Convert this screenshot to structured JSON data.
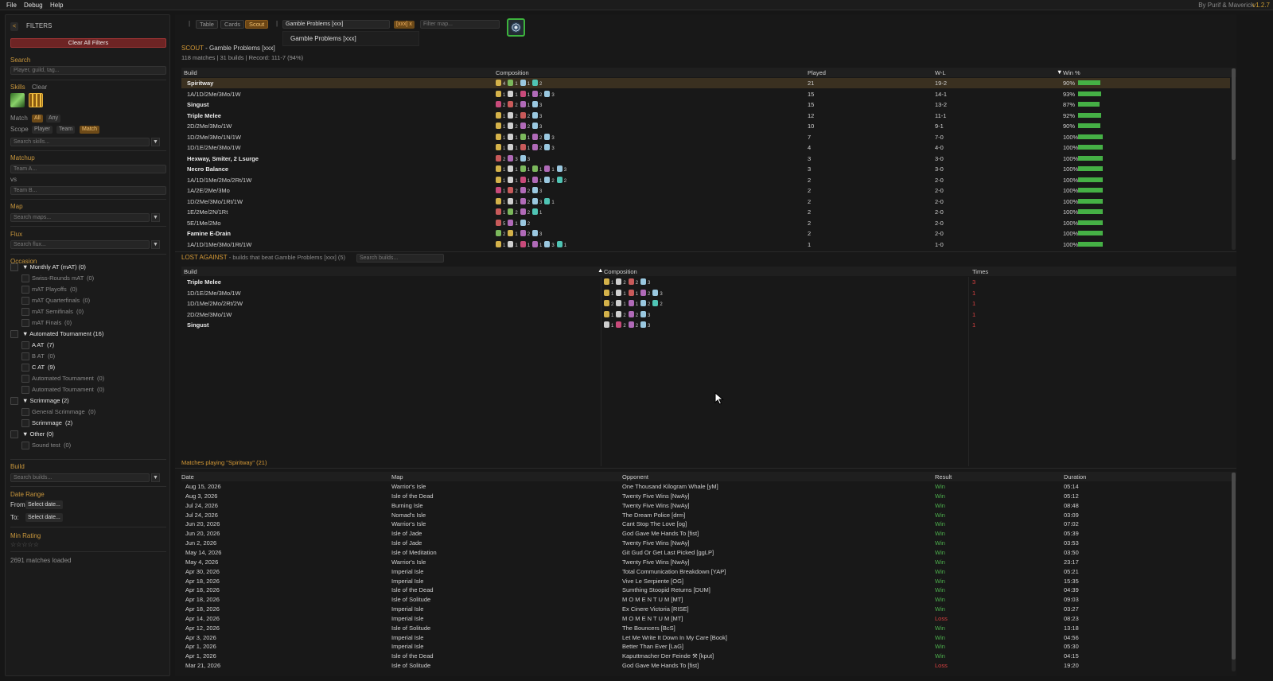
{
  "menu": {
    "file": "File",
    "debug": "Debug",
    "help": "Help",
    "credit": "By Purif & Maverick",
    "version": "v1.2.7"
  },
  "sidebar": {
    "back_label": "<",
    "title": "FILTERS",
    "clear_all": "Clear All Filters",
    "search": {
      "header": "Search",
      "placeholder": "Player, guild, tag..."
    },
    "skills": {
      "header": "Skills",
      "clear": "Clear",
      "search_placeholder": "Search skills..."
    },
    "match": {
      "label": "Match",
      "options": [
        "All",
        "Any"
      ],
      "selected": "All"
    },
    "scope": {
      "label": "Scope",
      "options": [
        "Player",
        "Team",
        "Match"
      ],
      "selected": "Match"
    },
    "matchup": {
      "header": "Matchup",
      "team_a": "Team A...",
      "vs": "vs",
      "team_b": "Team B..."
    },
    "map": {
      "header": "Map",
      "placeholder": "Search maps..."
    },
    "flux": {
      "header": "Flux",
      "placeholder": "Search flux..."
    },
    "occasion": {
      "header": "Occasion",
      "groups": [
        {
          "label": "▼ Monthly AT (mAT) (0)",
          "items": [
            {
              "label": "Swiss-Rounds mAT",
              "count": "(0)"
            },
            {
              "label": "mAT Playoffs",
              "count": "(0)"
            },
            {
              "label": "mAT Quarterfinals",
              "count": "(0)"
            },
            {
              "label": "mAT Semifinals",
              "count": "(0)"
            },
            {
              "label": "mAT Finals",
              "count": "(0)"
            }
          ]
        },
        {
          "label": "▼ Automated Tournament (16)",
          "items": [
            {
              "label": "A AT",
              "count": "(7)"
            },
            {
              "label": "B AT",
              "count": "(0)"
            },
            {
              "label": "C AT",
              "count": "(9)"
            },
            {
              "label": "Automated Tournament",
              "count": "(0)"
            },
            {
              "label": "Automated Tournament",
              "count": "(0)"
            }
          ]
        },
        {
          "label": "▼ Scrimmage (2)",
          "items": [
            {
              "label": "General Scrimmage",
              "count": "(0)"
            },
            {
              "label": "Scrimmage",
              "count": "(2)"
            }
          ]
        },
        {
          "label": "▼ Other (0)",
          "items": [
            {
              "label": "Sound test",
              "count": "(0)"
            }
          ]
        }
      ]
    },
    "build": {
      "header": "Build",
      "placeholder": "Search builds..."
    },
    "date_range": {
      "header": "Date Range",
      "from_label": "From",
      "from_value": "Select date...",
      "to_label": "To:",
      "to_value": "Select date..."
    },
    "min_rating": {
      "header": "Min Rating",
      "stars": "☆☆☆☆☆"
    },
    "status": "2691 matches loaded"
  },
  "toolbar": {
    "divider": "|",
    "tabs": [
      "Table",
      "Cards",
      "Scout"
    ],
    "active_tab": "Scout",
    "divider2": "|",
    "team_search_value": "Gamble Problems [xxx]",
    "team_tag": "[xxx] x",
    "filter_map_placeholder": "Filter map...",
    "dropdown_item": "Gamble Problems [xxx]"
  },
  "scout": {
    "label": "SCOUT",
    "team": "- Gamble Problems [xxx]",
    "summary": "118 matches | 31 builds | Record: 111-7 (94%)",
    "columns": [
      "Build",
      "Composition",
      "Played",
      "W-L",
      "Win %"
    ],
    "sort_indicator": "▼",
    "rows": [
      {
        "build": "Spiritway",
        "bold": true,
        "comp": [
          [
            "#d4b24a",
            "4"
          ],
          [
            "#7bb85c",
            "1"
          ],
          [
            "#9ac8e0",
            "1"
          ],
          [
            "#4fc4b4",
            "2"
          ]
        ],
        "played": "21",
        "wl": "19-2",
        "win": "90%",
        "winpct": 90
      },
      {
        "build": "1A/1D/2Me/3Mo/1W",
        "bold": false,
        "comp": [
          [
            "#d4b24a",
            "1"
          ],
          [
            "#cfcfcf",
            "1"
          ],
          [
            "#c84a7a",
            "1"
          ],
          [
            "#b06ab8",
            "2"
          ],
          [
            "#9ac8e0",
            "3"
          ]
        ],
        "played": "15",
        "wl": "14-1",
        "win": "93%",
        "winpct": 93
      },
      {
        "build": "Singust",
        "bold": true,
        "comp": [
          [
            "#c84a7a",
            "2"
          ],
          [
            "#c85a5a",
            "2"
          ],
          [
            "#b06ab8",
            "1"
          ],
          [
            "#9ac8e0",
            "3"
          ]
        ],
        "played": "15",
        "wl": "13-2",
        "win": "87%",
        "winpct": 87
      },
      {
        "build": "Triple Melee",
        "bold": true,
        "comp": [
          [
            "#d4b24a",
            "1"
          ],
          [
            "#cfcfcf",
            "2"
          ],
          [
            "#c85a5a",
            "2"
          ],
          [
            "#9ac8e0",
            "3"
          ]
        ],
        "played": "12",
        "wl": "11-1",
        "win": "92%",
        "winpct": 92
      },
      {
        "build": "2D/2Me/3Mo/1W",
        "bold": false,
        "comp": [
          [
            "#d4b24a",
            "1"
          ],
          [
            "#cfcfcf",
            "2"
          ],
          [
            "#b06ab8",
            "2"
          ],
          [
            "#9ac8e0",
            "3"
          ]
        ],
        "played": "10",
        "wl": "9-1",
        "win": "90%",
        "winpct": 90
      },
      {
        "build": "1D/2Me/3Mo/1N/1W",
        "bold": false,
        "comp": [
          [
            "#d4b24a",
            "1"
          ],
          [
            "#cfcfcf",
            "1"
          ],
          [
            "#7bb85c",
            "1"
          ],
          [
            "#b06ab8",
            "2"
          ],
          [
            "#9ac8e0",
            "3"
          ]
        ],
        "played": "7",
        "wl": "7-0",
        "win": "100%",
        "winpct": 100
      },
      {
        "build": "1D/1E/2Me/3Mo/1W",
        "bold": false,
        "comp": [
          [
            "#d4b24a",
            "1"
          ],
          [
            "#cfcfcf",
            "1"
          ],
          [
            "#c85a5a",
            "1"
          ],
          [
            "#b06ab8",
            "2"
          ],
          [
            "#9ac8e0",
            "3"
          ]
        ],
        "played": "4",
        "wl": "4-0",
        "win": "100%",
        "winpct": 100
      },
      {
        "build": "Hexway, Smiter, 2 Lsurge",
        "bold": true,
        "comp": [
          [
            "#c85a5a",
            "2"
          ],
          [
            "#b06ab8",
            "3"
          ],
          [
            "#9ac8e0",
            "3"
          ]
        ],
        "played": "3",
        "wl": "3-0",
        "win": "100%",
        "winpct": 100
      },
      {
        "build": "Necro Balance",
        "bold": true,
        "comp": [
          [
            "#d4b24a",
            "1"
          ],
          [
            "#cfcfcf",
            "1"
          ],
          [
            "#7bb85c",
            "1"
          ],
          [
            "#7bb85c",
            "1"
          ],
          [
            "#b06ab8",
            "1"
          ],
          [
            "#9ac8e0",
            "3"
          ]
        ],
        "played": "3",
        "wl": "3-0",
        "win": "100%",
        "winpct": 100
      },
      {
        "build": "1A/1D/1Me/2Mo/2Rt/1W",
        "bold": false,
        "comp": [
          [
            "#d4b24a",
            "1"
          ],
          [
            "#cfcfcf",
            "1"
          ],
          [
            "#c84a7a",
            "1"
          ],
          [
            "#b06ab8",
            "1"
          ],
          [
            "#9ac8e0",
            "2"
          ],
          [
            "#4fc4b4",
            "2"
          ]
        ],
        "played": "2",
        "wl": "2-0",
        "win": "100%",
        "winpct": 100
      },
      {
        "build": "1A/2E/2Me/3Mo",
        "bold": false,
        "comp": [
          [
            "#c84a7a",
            "1"
          ],
          [
            "#c85a5a",
            "2"
          ],
          [
            "#b06ab8",
            "2"
          ],
          [
            "#9ac8e0",
            "3"
          ]
        ],
        "played": "2",
        "wl": "2-0",
        "win": "100%",
        "winpct": 100
      },
      {
        "build": "1D/2Me/3Mo/1Rt/1W",
        "bold": false,
        "comp": [
          [
            "#d4b24a",
            "1"
          ],
          [
            "#cfcfcf",
            "1"
          ],
          [
            "#b06ab8",
            "2"
          ],
          [
            "#9ac8e0",
            "3"
          ],
          [
            "#4fc4b4",
            "1"
          ]
        ],
        "played": "2",
        "wl": "2-0",
        "win": "100%",
        "winpct": 100
      },
      {
        "build": "1E/2Me/2N/1Rt",
        "bold": false,
        "comp": [
          [
            "#c85a5a",
            "1"
          ],
          [
            "#7bb85c",
            "2"
          ],
          [
            "#b06ab8",
            "2"
          ],
          [
            "#4fc4b4",
            "1"
          ]
        ],
        "played": "2",
        "wl": "2-0",
        "win": "100%",
        "winpct": 100
      },
      {
        "build": "5E/1Me/2Mo",
        "bold": false,
        "comp": [
          [
            "#c85a5a",
            "5"
          ],
          [
            "#b06ab8",
            "1"
          ],
          [
            "#9ac8e0",
            "2"
          ]
        ],
        "played": "2",
        "wl": "2-0",
        "win": "100%",
        "winpct": 100
      },
      {
        "build": "Famine E-Drain",
        "bold": true,
        "comp": [
          [
            "#7bb85c",
            "2"
          ],
          [
            "#d4b24a",
            "1"
          ],
          [
            "#b06ab8",
            "2"
          ],
          [
            "#9ac8e0",
            "3"
          ]
        ],
        "played": "2",
        "wl": "2-0",
        "win": "100%",
        "winpct": 100
      },
      {
        "build": "1A/1D/1Me/3Mo/1Rt/1W",
        "bold": false,
        "comp": [
          [
            "#d4b24a",
            "1"
          ],
          [
            "#cfcfcf",
            "1"
          ],
          [
            "#c84a7a",
            "1"
          ],
          [
            "#b06ab8",
            "1"
          ],
          [
            "#9ac8e0",
            "3"
          ],
          [
            "#4fc4b4",
            "1"
          ]
        ],
        "played": "1",
        "wl": "1-0",
        "win": "100%",
        "winpct": 100
      }
    ]
  },
  "lost": {
    "label": "LOST AGAINST",
    "subtitle": "- builds that beat Gamble Problems [xxx] (5)",
    "search_placeholder": "Search builds...",
    "columns": [
      "Build",
      "Composition",
      "Times"
    ],
    "sort_indicator": "▲",
    "rows": [
      {
        "build": "Triple Melee",
        "bold": true,
        "comp": [
          [
            "#d4b24a",
            "1"
          ],
          [
            "#cfcfcf",
            "2"
          ],
          [
            "#c85a5a",
            "2"
          ],
          [
            "#9ac8e0",
            "3"
          ]
        ],
        "times": "3"
      },
      {
        "build": "1D/1E/2Me/3Mo/1W",
        "bold": false,
        "comp": [
          [
            "#d4b24a",
            "1"
          ],
          [
            "#cfcfcf",
            "1"
          ],
          [
            "#c85a5a",
            "1"
          ],
          [
            "#b06ab8",
            "2"
          ],
          [
            "#9ac8e0",
            "3"
          ]
        ],
        "times": "1"
      },
      {
        "build": "1D/1Me/2Mo/2Rt/2W",
        "bold": false,
        "comp": [
          [
            "#d4b24a",
            "2"
          ],
          [
            "#cfcfcf",
            "1"
          ],
          [
            "#b06ab8",
            "1"
          ],
          [
            "#9ac8e0",
            "2"
          ],
          [
            "#4fc4b4",
            "2"
          ]
        ],
        "times": "1"
      },
      {
        "build": "2D/2Me/3Mo/1W",
        "bold": false,
        "comp": [
          [
            "#d4b24a",
            "1"
          ],
          [
            "#cfcfcf",
            "2"
          ],
          [
            "#b06ab8",
            "2"
          ],
          [
            "#9ac8e0",
            "3"
          ]
        ],
        "times": "1"
      },
      {
        "build": "Singust",
        "bold": true,
        "comp": [
          [
            "#cfcfcf",
            "1"
          ],
          [
            "#c84a7a",
            "2"
          ],
          [
            "#b06ab8",
            "2"
          ],
          [
            "#9ac8e0",
            "3"
          ]
        ],
        "times": "1"
      }
    ]
  },
  "matches": {
    "title": "Matches playing \"Spiritway\" (21)",
    "columns": [
      "Date",
      "Map",
      "Opponent",
      "Result",
      "Duration"
    ],
    "rows": [
      {
        "date": "Aug 15, 2026",
        "map": "Warrior's Isle",
        "opp": "One Thousand Kilogram Whale [yM]",
        "result": "Win",
        "dur": "05:14"
      },
      {
        "date": "Aug 3, 2026",
        "map": "Isle of the Dead",
        "opp": "Twenty Five Wins [NwAy]",
        "result": "Win",
        "dur": "05:12"
      },
      {
        "date": "Jul 24, 2026",
        "map": "Burning Isle",
        "opp": "Twenty Five Wins [NwAy]",
        "result": "Win",
        "dur": "08:48"
      },
      {
        "date": "Jul 24, 2026",
        "map": "Nomad's Isle",
        "opp": "The Dream Police [drm]",
        "result": "Win",
        "dur": "03:09"
      },
      {
        "date": "Jun 20, 2026",
        "map": "Warrior's Isle",
        "opp": "Cant Stop The Love [og]",
        "result": "Win",
        "dur": "07:02"
      },
      {
        "date": "Jun 20, 2026",
        "map": "Isle of Jade",
        "opp": "God Gave Me Hands To [fist]",
        "result": "Win",
        "dur": "05:39"
      },
      {
        "date": "Jun 2, 2026",
        "map": "Isle of Jade",
        "opp": "Twenty Five Wins [NwAy]",
        "result": "Win",
        "dur": "03:53"
      },
      {
        "date": "May 14, 2026",
        "map": "Isle of Meditation",
        "opp": "Git Gud Or Get Last Picked [ggLP]",
        "result": "Win",
        "dur": "03:50"
      },
      {
        "date": "May 4, 2026",
        "map": "Warrior's Isle",
        "opp": "Twenty Five Wins [NwAy]",
        "result": "Win",
        "dur": "23:17"
      },
      {
        "date": "Apr 30, 2026",
        "map": "Imperial Isle",
        "opp": "Total Communication Breakdown [YAP]",
        "result": "Win",
        "dur": "05:21"
      },
      {
        "date": "Apr 18, 2026",
        "map": "Imperial Isle",
        "opp": "Vive Le Serpiente [OG]",
        "result": "Win",
        "dur": "15:35"
      },
      {
        "date": "Apr 18, 2026",
        "map": "Isle of the Dead",
        "opp": "Sumthing Stoopid Returns [DUM]",
        "result": "Win",
        "dur": "04:39"
      },
      {
        "date": "Apr 18, 2026",
        "map": "Isle of Solitude",
        "opp": "M O M E N T U M [MT]",
        "result": "Win",
        "dur": "09:03"
      },
      {
        "date": "Apr 18, 2026",
        "map": "Imperial Isle",
        "opp": "Ex Cinere Victoria [RISE]",
        "result": "Win",
        "dur": "03:27"
      },
      {
        "date": "Apr 14, 2026",
        "map": "Imperial Isle",
        "opp": "M O M E N T U M [MT]",
        "result": "Loss",
        "dur": "08:23"
      },
      {
        "date": "Apr 12, 2026",
        "map": "Isle of Solitude",
        "opp": "The Bouncers [BcS]",
        "result": "Win",
        "dur": "13:18"
      },
      {
        "date": "Apr 3, 2026",
        "map": "Imperial Isle",
        "opp": "Let Me Write It Down In My Care [Book]",
        "result": "Win",
        "dur": "04:56"
      },
      {
        "date": "Apr 1, 2026",
        "map": "Imperial Isle",
        "opp": "Better Than Ever [LaG]",
        "result": "Win",
        "dur": "05:30"
      },
      {
        "date": "Apr 1, 2026",
        "map": "Isle of the Dead",
        "opp": "Kaputtmacher Der Feinde ⚒ [kput]",
        "result": "Win",
        "dur": "04:15"
      },
      {
        "date": "Mar 21, 2026",
        "map": "Isle of Solitude",
        "opp": "God Gave Me Hands To [fist]",
        "result": "Loss",
        "dur": "19:20"
      }
    ]
  },
  "colors": {
    "accent": "#d69a36",
    "win": "#4cae4c",
    "loss": "#d84040",
    "bar": "#45b045"
  }
}
